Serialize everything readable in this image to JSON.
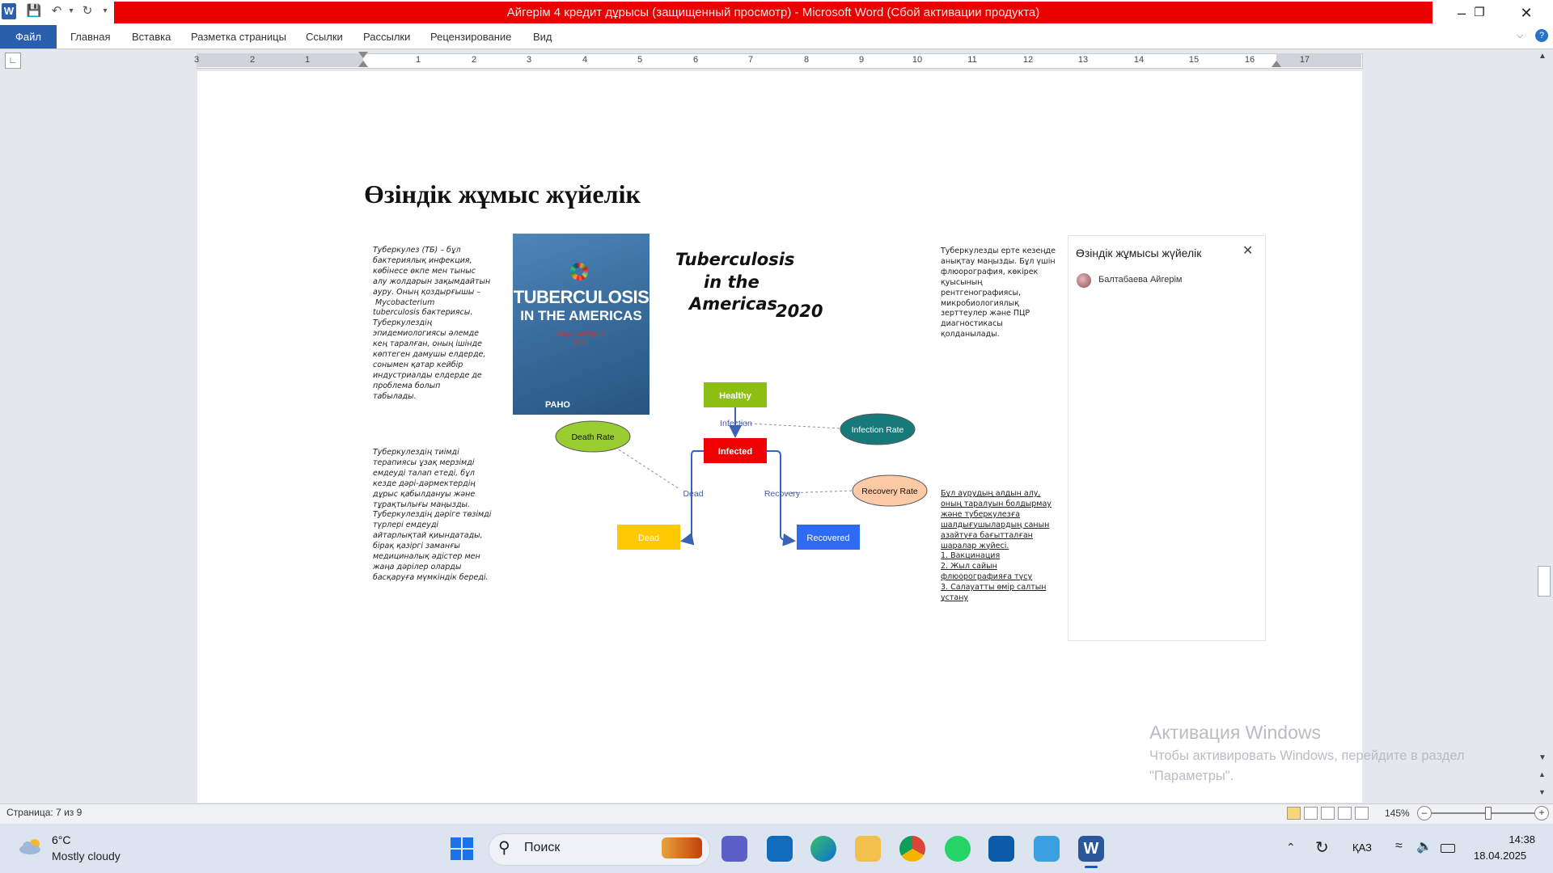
{
  "window": {
    "title": "Айгерім 4 кредит дұрысы (защищенный просмотр)  -  Microsoft Word (Сбой активации продукта)",
    "app_icon": "W"
  },
  "ribbon": {
    "file_tab": "Файл",
    "tabs": [
      "Главная",
      "Вставка",
      "Разметка страницы",
      "Ссылки",
      "Рассылки",
      "Рецензирование",
      "Вид"
    ]
  },
  "ruler": {
    "labels": [
      "3",
      "2",
      "1",
      "1",
      "2",
      "3",
      "4",
      "5",
      "6",
      "7",
      "8",
      "9",
      "10",
      "11",
      "12",
      "13",
      "14",
      "15",
      "16",
      "17"
    ]
  },
  "document": {
    "heading": "Өзіндік жұмыс жүйелік",
    "left_para_1": [
      "Туберкулез (ТБ) – бұл",
      "бактериялық инфекция,",
      "көбінесе өкпе мен тыныс",
      "алу жолдарын зақымдайтын",
      "ауру. Оның қоздырғышы –",
      " Mycobacterium",
      "tuberculosis бактериясы.",
      "Туберкулездің",
      "эпидемиологиясы әлемде",
      "кең таралған, оның ішінде",
      "көптеген дамушы елдерде,",
      "сонымен қатар кейбір",
      "индустриалды елдерде де",
      "проблема болып",
      "табылады."
    ],
    "left_para_2": [
      "Туберкулездің тиімді",
      "терапиясы ұзақ мерзімді",
      "емдеуді талап етеді, бұл",
      "кезде дәрі-дәрмектердің",
      "дұрыс қабылдануы және",
      "тұрақтылығы маңызды.",
      "Туберкулездің дәріге төзімді",
      "түрлері емдеуді",
      "айтарлықтай қиындатады,",
      "бірақ қазіргі заманғы",
      "медициналық әдістер мен",
      "жаңа дәрілер оларды",
      "басқаруға мүмкіндік береді."
    ],
    "right_para_1": [
      "Туберкулезды ерте кезеңде",
      "анықтау маңызды. Бұл үшін",
      "флюорография, көкірек",
      "қуысының",
      "рентгенографиясы,",
      "микробиологиялық",
      "зерттеулер және ПЦР",
      "диагностикасы",
      "қолданылады."
    ],
    "right_para_2": [
      "Бұл аурудың алдын алу,",
      "оның таралуын болдырмау",
      "және туберкулезға",
      "шалдығушылардың санын",
      "азайтуға бағытталған",
      "шаралар жүйесі.",
      "1. Вакцинация",
      "2. Жыл сайын",
      "флюорографияға түсу",
      "3. Салауатты өмір салтын",
      "ұстану"
    ],
    "cover": {
      "title_line1": "TUBERCULOSIS",
      "title_line2": "IN THE AMERICAS",
      "subtitle": "Regional Report",
      "year": "2021",
      "publisher": "PAHO"
    },
    "hand_title": {
      "line1": "Tuberculosis",
      "line2": "in the",
      "line3": "Americas",
      "year": "2020"
    },
    "diagram": {
      "healthy": "Healthy",
      "infected": "Infected",
      "dead": "Dead",
      "recovered": "Recovered",
      "death_rate": "Death Rate",
      "infection_rate": "Infection Rate",
      "recovery_rate": "Recovery Rate",
      "edge_infection": "Infection",
      "edge_dead": "Dead",
      "edge_recovery": "Recovery"
    }
  },
  "comment_pane": {
    "title": "Өзіндік жұмысы жүйелік",
    "author": "Балтабаева Айгерім"
  },
  "activation": {
    "line1": "Активация Windows",
    "line2": "Чтобы активировать Windows, перейдите в раздел",
    "line3": "\"Параметры\"."
  },
  "statusbar": {
    "page": "Страница: 7 из 9",
    "zoom": "145%"
  },
  "taskbar": {
    "weather_temp": "6°C",
    "weather_desc": "Mostly cloudy",
    "search": "Поиск",
    "lang": "ҚАЗ",
    "time": "14:38",
    "date": "18.04.2025"
  },
  "colors": {
    "title_red": "#ea0000",
    "file_tab": "#2a5fae",
    "healthy": "#8cbf12",
    "infected": "#f00000",
    "dead": "#ffc800",
    "recovered": "#2f6bf2",
    "death_rate": "#9acd32",
    "infection_rate": "#167a7a",
    "recovery_rate": "#ffcaa6"
  }
}
